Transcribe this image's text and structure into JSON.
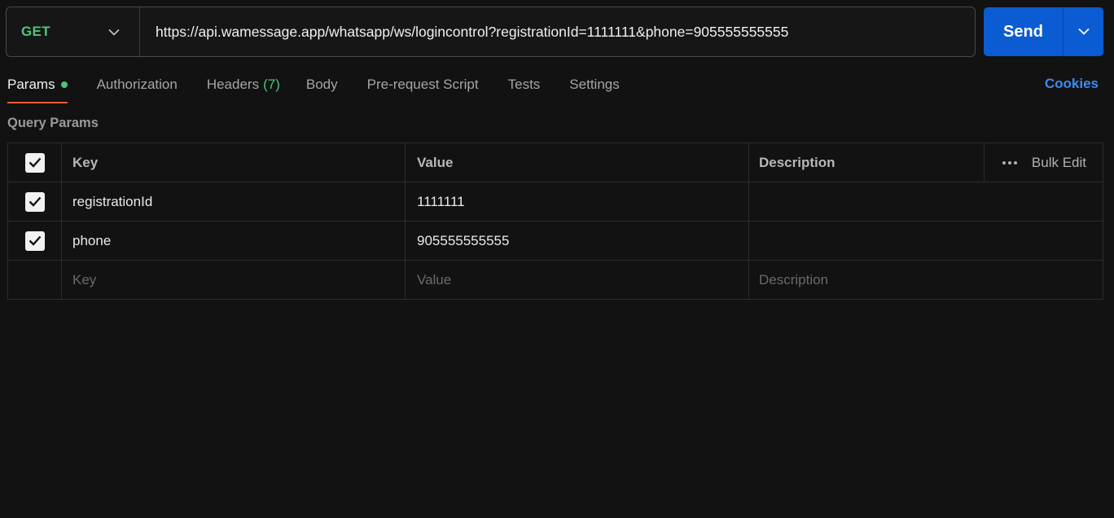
{
  "request": {
    "method": "GET",
    "url": "https://api.wamessage.app/whatsapp/ws/logincontrol?registrationId=1111111&phone=905555555555",
    "send_label": "Send"
  },
  "tabs": [
    {
      "label": "Params"
    },
    {
      "label": "Authorization"
    },
    {
      "label": "Headers",
      "count": "(7)"
    },
    {
      "label": "Body"
    },
    {
      "label": "Pre-request Script"
    },
    {
      "label": "Tests"
    },
    {
      "label": "Settings"
    }
  ],
  "cookies_label": "Cookies",
  "query_params": {
    "title": "Query Params",
    "headers": {
      "key": "Key",
      "value": "Value",
      "description": "Description",
      "bulk_edit": "Bulk Edit"
    },
    "rows": [
      {
        "key": "registrationId",
        "value": "1111111",
        "description": "",
        "checked": true
      },
      {
        "key": "phone",
        "value": "905555555555",
        "description": "",
        "checked": true
      }
    ],
    "placeholders": {
      "key": "Key",
      "value": "Value",
      "description": "Description"
    }
  },
  "colors": {
    "accent": "#0b5bd3",
    "method": "#4fc37a",
    "active_tab_underline": "#f05a3a",
    "link": "#3d8bf0"
  }
}
